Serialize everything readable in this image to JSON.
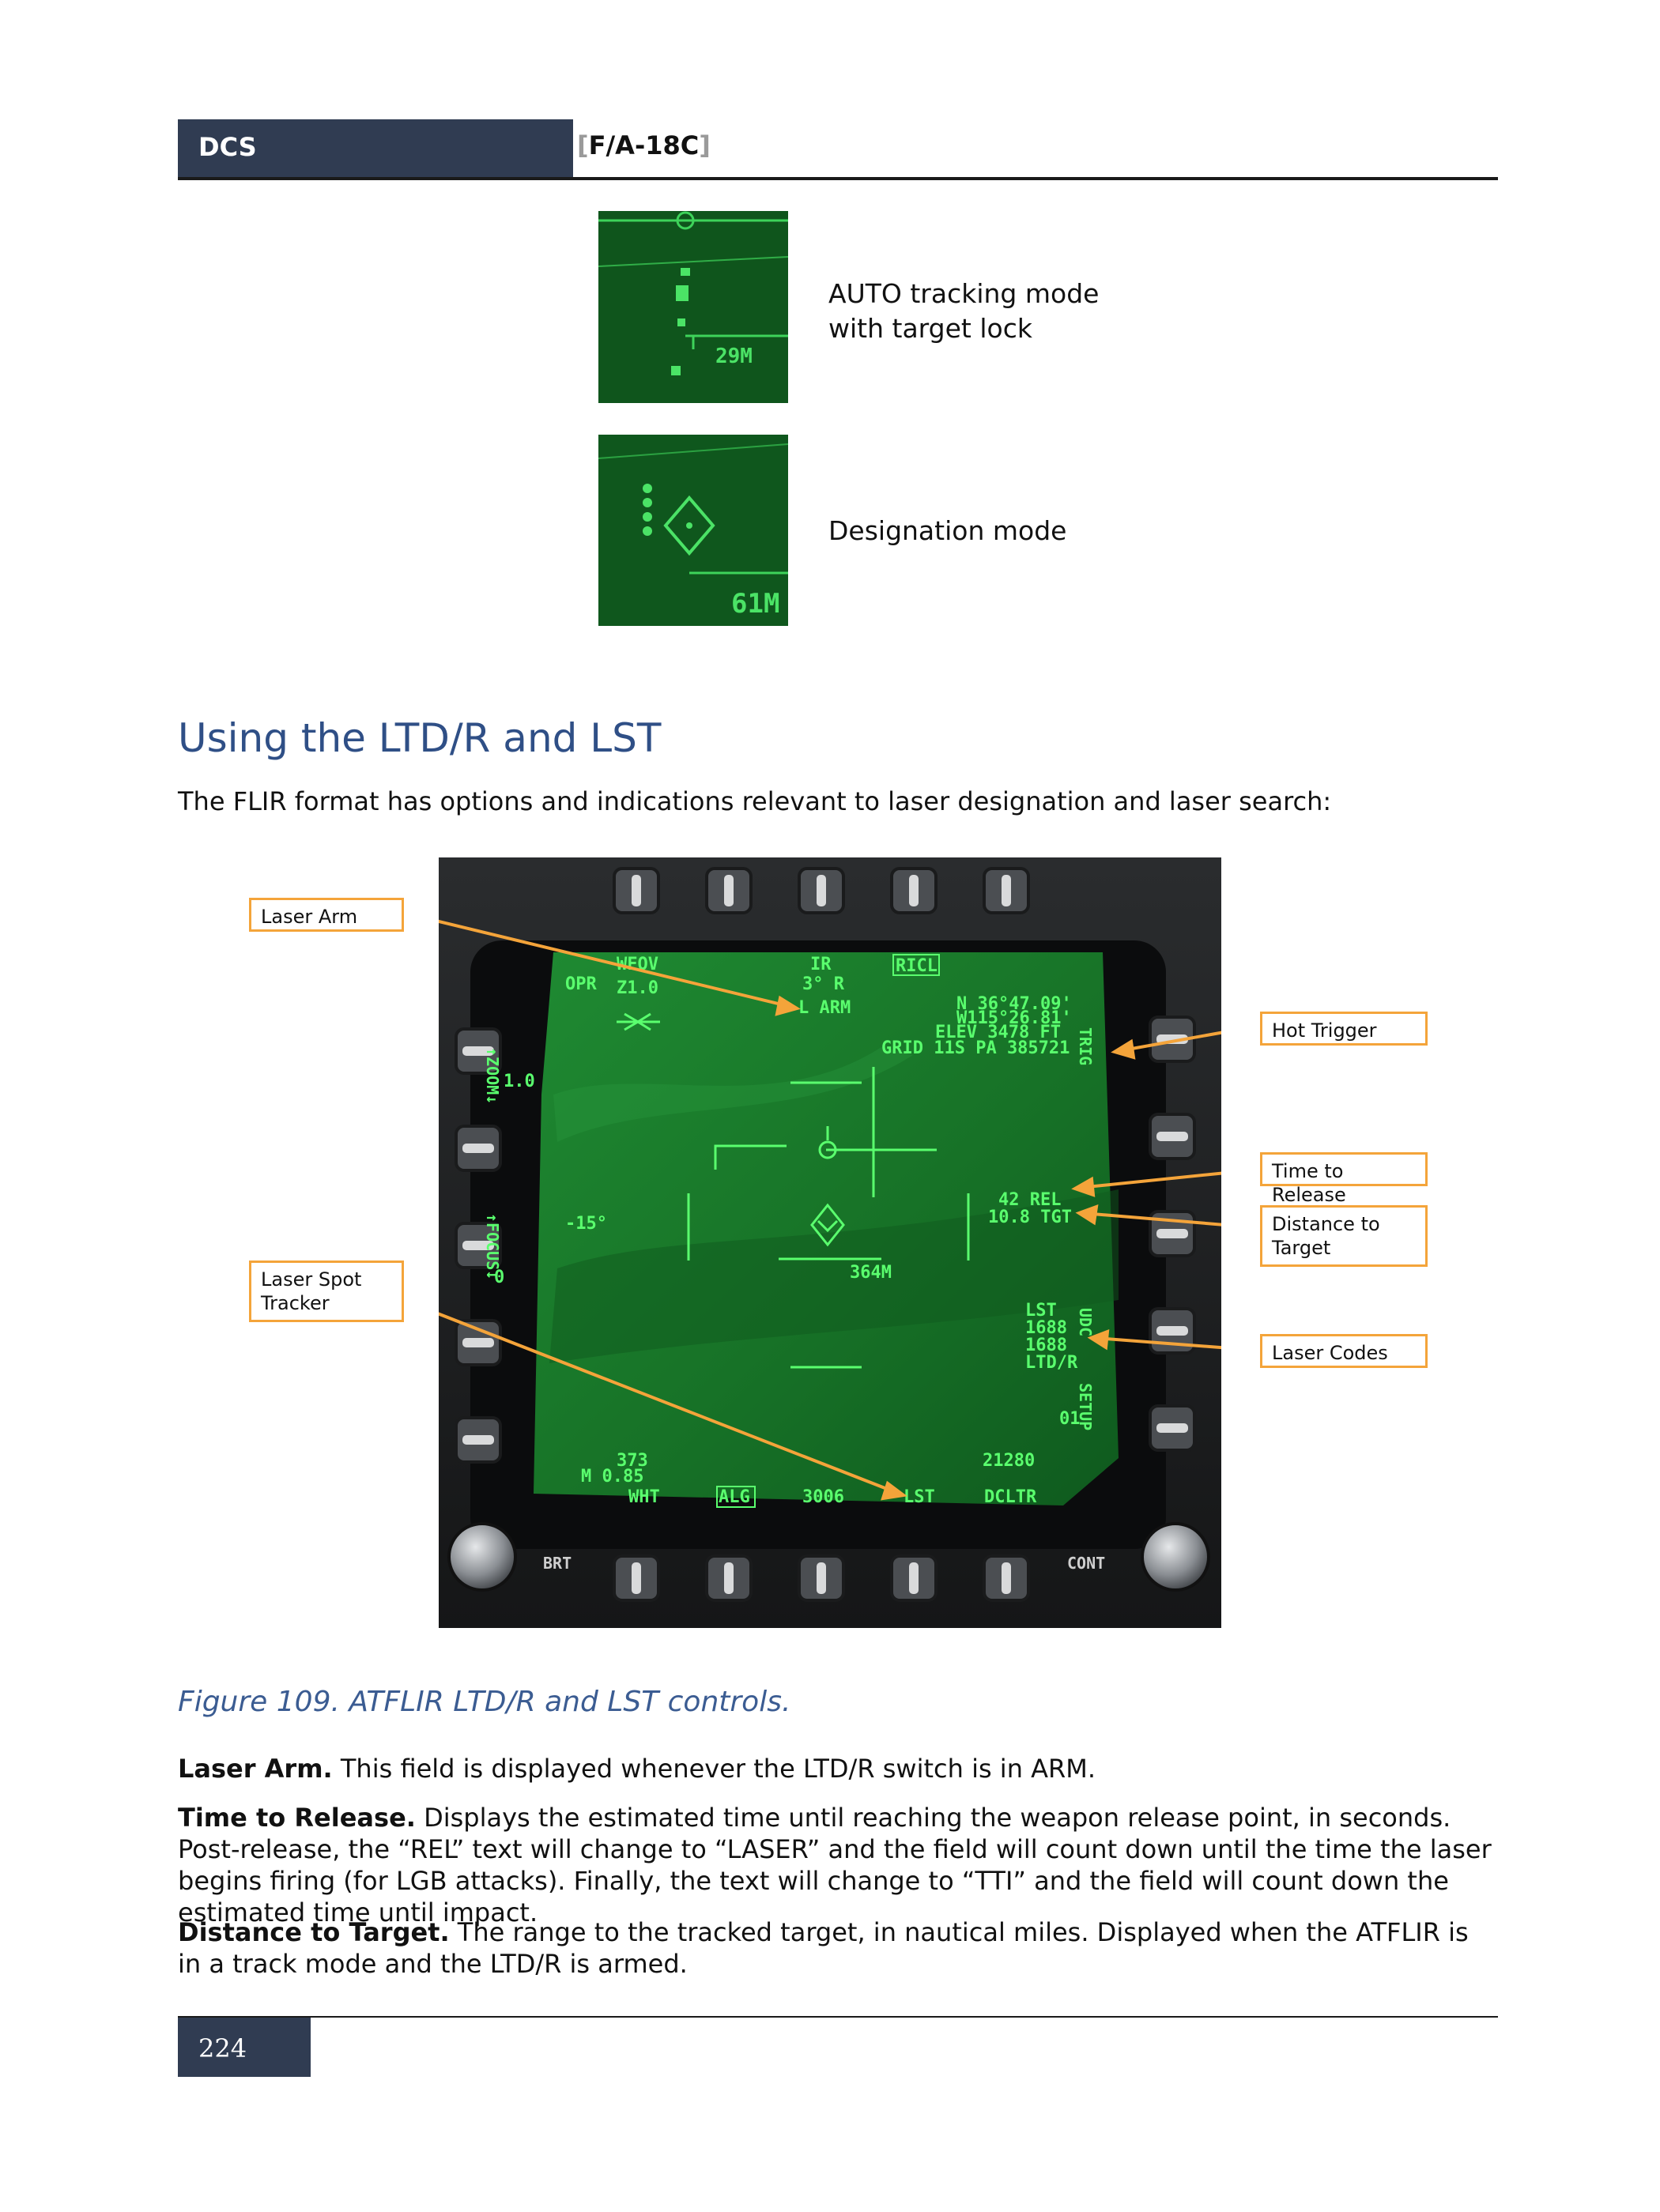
{
  "header": {
    "left_label": "DCS",
    "right_title": "F/A-18C"
  },
  "thumbnails": [
    {
      "caption_lines": [
        "AUTO tracking mode",
        "with target lock"
      ],
      "range_readout": "29M"
    },
    {
      "caption_lines": [
        "Designation mode"
      ],
      "range_readout": "61M"
    }
  ],
  "section": {
    "heading": "Using the LTD/R and LST",
    "intro": "The FLIR format has options and indications relevant to laser designation and laser search:"
  },
  "mfd": {
    "callouts": {
      "laser_arm": "Laser Arm",
      "laser_spot_tracker": "Laser Spot Tracker",
      "hot_trigger": "Hot Trigger",
      "time_to_release": "Time to Release",
      "distance_to_target": "Distance to Target",
      "laser_codes": "Laser Codes"
    },
    "display": {
      "wfov": "WFOV",
      "opr": "OPR",
      "z10": "Z1.0",
      "ir": "IR",
      "deg": "3° R",
      "ricl": "RICL",
      "l_arm": "L ARM",
      "lat": "N 36°47.09'",
      "lon": "W115°26.81'",
      "elev": "ELEV  3478 FT",
      "grid": "GRID 11S PA 385721",
      "trig": "TRIG",
      "zoom": "↑ZOOM↓",
      "zoom_val": "1.0",
      "focus": "↑FOCUS↓",
      "focus_val": "0",
      "angle": "-15°",
      "rel": "42 REL",
      "tgt": "10.8 TGT",
      "range": "364M",
      "lst_lbl": "LST",
      "code1": "1688",
      "code2": "1688",
      "ltdr": "LTD/R",
      "udc": "UDC",
      "setup": "SETUP",
      "o1": "01",
      "alt": "373",
      "mach": "M 0.85",
      "wht": "WHT",
      "alg": "ALG",
      "code_bottom": "3006",
      "lst_btn": "LST",
      "alt2": "21280",
      "dcltr": "DCLTR",
      "brt": "BRT",
      "cont": "CONT"
    }
  },
  "figure_caption": "Figure 109. ATFLIR LTD/R and LST controls.",
  "paragraphs": [
    {
      "term": "Laser Arm.",
      "text": " This field is displayed whenever the LTD/R switch is in ARM."
    },
    {
      "term": "Time to Release.",
      "text": " Displays the estimated time until reaching the weapon release point, in seconds. Post-release, the “REL” text will change to “LASER” and the field will count down until the time the laser begins firing (for LGB attacks). Finally, the text will change to “TTI” and the field will count down the estimated time until impact."
    },
    {
      "term": "Distance to Target.",
      "text": " The range to the tracked target, in nautical miles. Displayed when the ATFLIR is in a track mode and the LTD/R is armed."
    }
  ],
  "footer": {
    "page_number": "224"
  }
}
